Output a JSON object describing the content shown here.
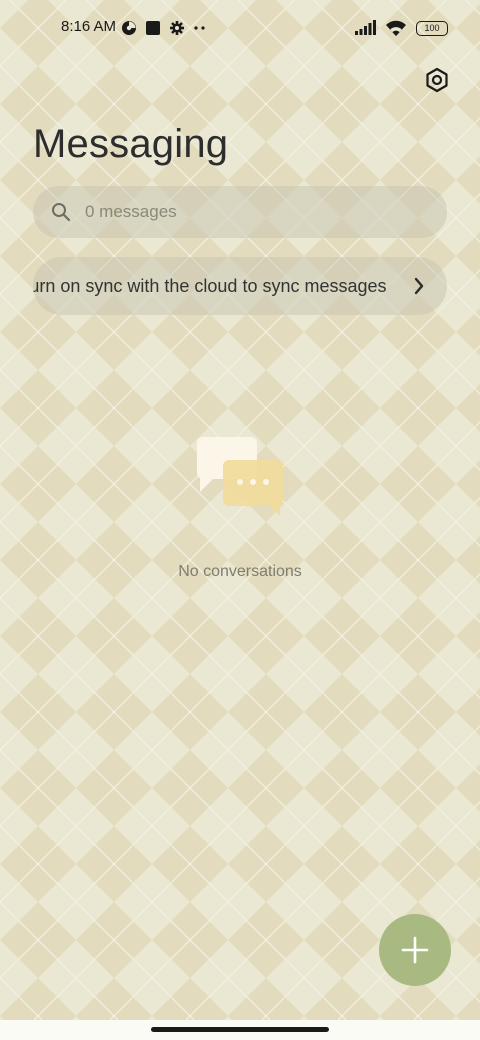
{
  "status_bar": {
    "time": "8:16 AM",
    "battery": "100",
    "left_icons": [
      "location-icon",
      "app-square-icon",
      "settings-gear-icon",
      "more-dots-icon"
    ],
    "right_icons": [
      "signal-icon",
      "wifi-icon",
      "battery-icon"
    ]
  },
  "header": {
    "title": "Messaging",
    "settings_icon": "settings-hex-icon"
  },
  "search": {
    "placeholder": "0 messages",
    "value": ""
  },
  "sync_banner": {
    "text": "Turn on sync with the cloud to sync messages"
  },
  "empty_state": {
    "text": "No conversations",
    "illustration": "chat-bubbles-icon"
  },
  "fab": {
    "icon": "plus-icon",
    "color": "#a8ba82"
  },
  "colors": {
    "background": "#eae8d2",
    "pattern": "#e2dbbd",
    "accent": "#a8ba82"
  }
}
